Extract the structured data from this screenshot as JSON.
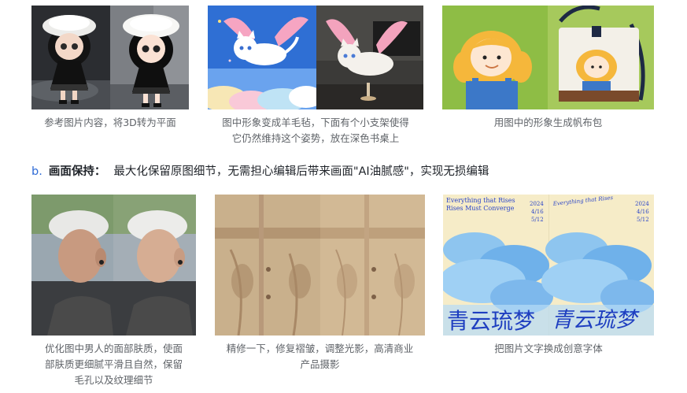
{
  "row1": {
    "items": [
      {
        "name": "doll-3d-to-flat",
        "caption_lines": [
          "参考图片内容，将3D转为平面"
        ]
      },
      {
        "name": "cat-felt-figure",
        "caption_lines": [
          "图中形象变成羊毛毡，下面有个小支架使得",
          "它仍然维持这个姿势，放在深色书桌上"
        ]
      },
      {
        "name": "girl-canvas-bag",
        "caption_lines": [
          "用图中的形象生成帆布包"
        ]
      }
    ]
  },
  "section_b": {
    "marker": "b.",
    "title": "画面保持：",
    "description": "最大化保留原图细节，无需担心编辑后带来画面\"AI油腻感\"，实现无损编辑"
  },
  "row2": {
    "items": [
      {
        "name": "man-skin-retouch",
        "caption_lines": [
          "优化图中男人的面部肤质，使面",
          "部肤质更细腻平滑且自然，保留",
          "毛孔以及纹理细节"
        ]
      },
      {
        "name": "coat-product-retouch",
        "caption_lines": [
          "精修一下，修复褶皱，调整光影，高清商业",
          "产品摄影"
        ]
      },
      {
        "name": "poster-font-change",
        "caption_lines": [
          "把图片文字换成创意字体"
        ]
      }
    ],
    "poster_text": {
      "heading_line1": "Everything that Rises",
      "heading_line2": "Rises Must Converge",
      "dates": [
        "2024",
        "4/16",
        "5/12"
      ],
      "chinese_title_left": "青云琉梦",
      "chinese_title_right": "青云琉梦"
    }
  }
}
